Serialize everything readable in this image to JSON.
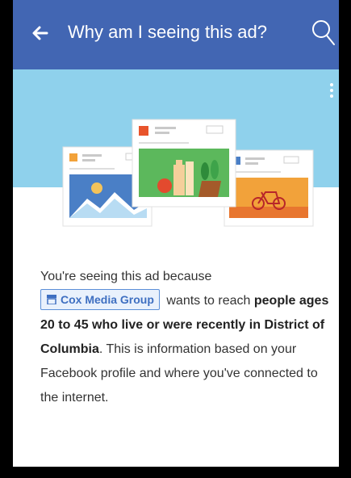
{
  "header": {
    "title": "Why am I seeing this ad?",
    "back_icon": "back-arrow-icon",
    "search_icon": "search-icon"
  },
  "hero": {
    "menu_icon": "more-vertical-icon"
  },
  "explanation": {
    "intro": "You're seeing this ad because",
    "advertiser": "Cox Media Group",
    "advertiser_icon": "store-icon",
    "reach": "wants to reach",
    "audience": "people ages 20 to 45 who live or were recently in District of Columbia",
    "period": ".",
    "detail": "This is information based on your Facebook profile and where you've connected to the internet."
  },
  "colors": {
    "header": "#4266b3",
    "hero_bg": "#8fd1ec",
    "tag_border": "#5b8fd8"
  }
}
